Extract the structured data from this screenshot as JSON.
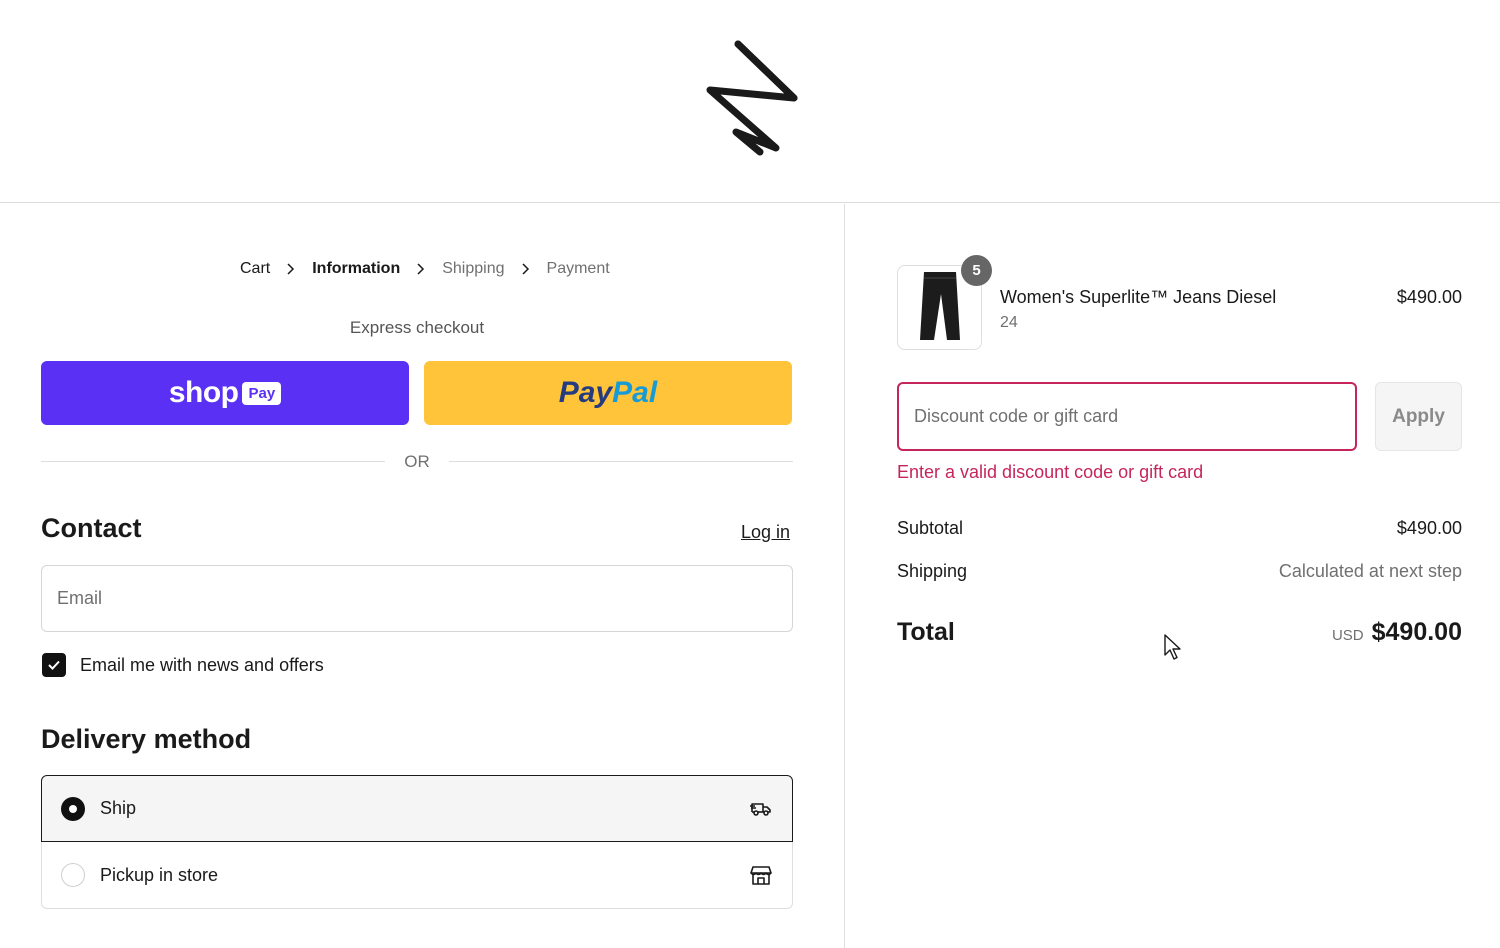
{
  "header": {
    "logo_icon": "brand-zigzag-logo"
  },
  "breadcrumb": {
    "items": [
      {
        "label": "Cart",
        "state": "link"
      },
      {
        "label": "Information",
        "state": "current"
      },
      {
        "label": "Shipping",
        "state": "upcoming"
      },
      {
        "label": "Payment",
        "state": "upcoming"
      }
    ]
  },
  "express": {
    "label": "Express checkout",
    "shoppay": {
      "shop_text": "shop",
      "pay_text": "Pay",
      "color": "#5a31f4"
    },
    "paypal": {
      "text_a": "Pay",
      "text_b": "Pal",
      "color": "#ffc439"
    },
    "or_text": "OR"
  },
  "contact": {
    "heading": "Contact",
    "login_link": "Log in",
    "email_placeholder": "Email",
    "email_value": "",
    "newsletter_label": "Email me with news and offers",
    "newsletter_checked": true
  },
  "delivery": {
    "heading": "Delivery method",
    "options": [
      {
        "label": "Ship",
        "selected": true,
        "icon": "delivery-truck-icon"
      },
      {
        "label": "Pickup in store",
        "selected": false,
        "icon": "store-icon"
      }
    ]
  },
  "summary": {
    "product": {
      "name": "Women's Superlite™ Jeans Diesel",
      "variant": "24",
      "price": "$490.00",
      "quantity": "5",
      "image_icon": "jeans-thumbnail"
    },
    "discount": {
      "placeholder": "Discount code or gift card",
      "value": "",
      "apply_label": "Apply",
      "error": "Enter a valid discount code or gift card",
      "error_color": "#c6255c"
    },
    "subtotal_label": "Subtotal",
    "subtotal_value": "$490.00",
    "shipping_label": "Shipping",
    "shipping_value": "Calculated at next step",
    "total_label": "Total",
    "total_currency": "USD",
    "total_value": "$490.00"
  }
}
